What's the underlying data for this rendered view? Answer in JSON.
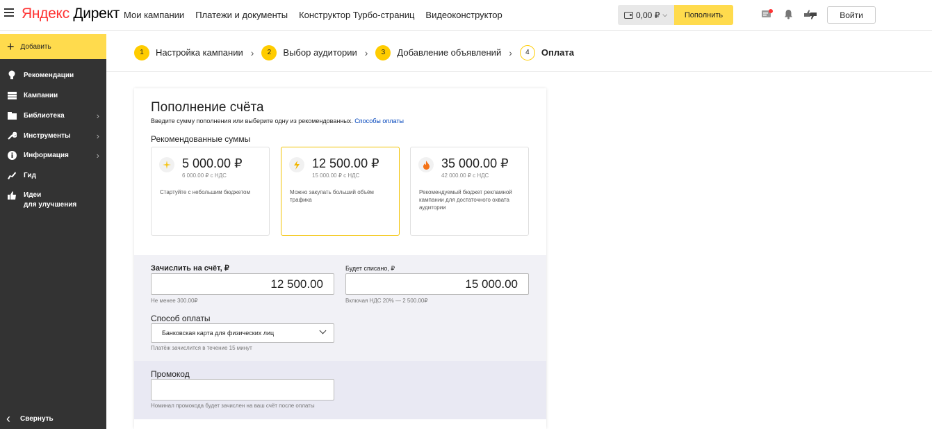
{
  "header": {
    "logo_part1": "Яндекс",
    "logo_part2": " Директ",
    "nav": [
      "Мои кампании",
      "Платежи и документы",
      "Конструктор Турбо-страниц",
      "Видеоконструктор"
    ],
    "balance": "0,00 ₽",
    "topup_label": "Пополнить",
    "login_label": "Войти"
  },
  "sidebar": {
    "add_label": "Добавить",
    "items": [
      {
        "label": "Рекомендации",
        "icon": "lightbulb-icon",
        "has_chevron": false
      },
      {
        "label": "Кампании",
        "icon": "list-icon",
        "has_chevron": false
      },
      {
        "label": "Библиотека",
        "icon": "library-icon",
        "has_chevron": true
      },
      {
        "label": "Инструменты",
        "icon": "wrench-icon",
        "has_chevron": true
      },
      {
        "label": "Информация",
        "icon": "info-icon",
        "has_chevron": true
      },
      {
        "label": "Гид",
        "icon": "guide-icon",
        "has_chevron": false
      },
      {
        "label": "Идеи",
        "label2": "для улучшения",
        "icon": "thumbs-up-icon",
        "has_chevron": false
      }
    ],
    "collapse_label": "Свернуть"
  },
  "stepper": {
    "steps": [
      {
        "num": "1",
        "label": "Настройка кампании"
      },
      {
        "num": "2",
        "label": "Выбор аудитории"
      },
      {
        "num": "3",
        "label": "Добавление объявлений"
      },
      {
        "num": "4",
        "label": "Оплата"
      }
    ]
  },
  "topup": {
    "title": "Пополнение счёта",
    "subtitle": "Введите сумму пополнения или выберите одну из рекомендованных.",
    "subtitle_link": "Способы оплаты",
    "recommended_label": "Рекомендованные суммы",
    "amounts": [
      {
        "amount": "5 000.00 ₽",
        "vat": "6 000.00 ₽ с НДС",
        "desc": "Стартуйте с небольшим бюджетом",
        "icon": "sparkle-icon"
      },
      {
        "amount": "12 500.00 ₽",
        "vat": "15 000.00 ₽ с НДС",
        "desc": "Можно закупать больший объём трафика",
        "icon": "lightning-icon"
      },
      {
        "amount": "35 000.00 ₽",
        "vat": "42 000.00 ₽ с НДС",
        "desc": "Рекомендуемый бюджет рекламной кампании для достаточного охвата аудитории",
        "icon": "fire-icon"
      }
    ],
    "selected_index": 1,
    "credit_label": "Зачислить на счёт, ₽",
    "credit_value": "12 500.00",
    "credit_hint": "Не менее 300.00₽",
    "charge_label": "Будет списано, ₽",
    "charge_value": "15 000.00",
    "charge_hint": "Включая НДС 20% — 2 500.00₽",
    "method_label": "Способ оплаты",
    "method_value": "Банковская карта для физических лиц",
    "method_hint": "Платёж зачислится в течение 15 минут",
    "promo_label": "Промокод",
    "promo_value": "",
    "promo_hint": "Номинал промокода будет зачислен на ваш счёт после оплаты"
  },
  "colors": {
    "accent_yellow": "#ffdb4d",
    "sidebar_bg": "#333333",
    "link_blue": "#0044bb"
  }
}
